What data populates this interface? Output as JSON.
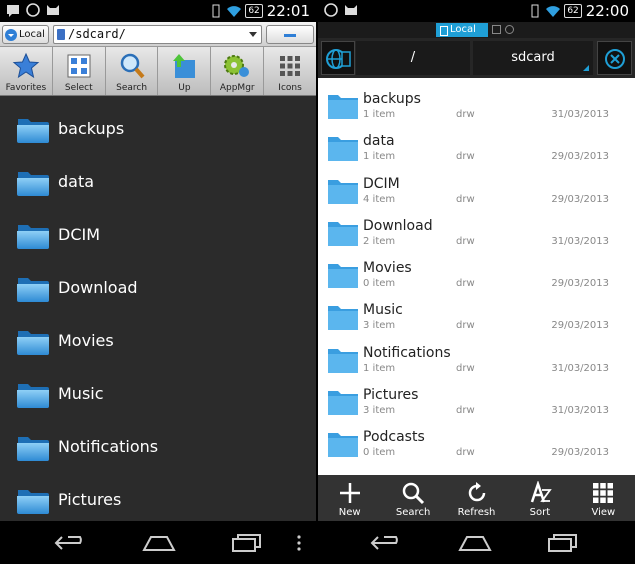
{
  "left_screen": {
    "status": {
      "battery": "62",
      "time": "22:01"
    },
    "location_button": "Local",
    "path": "/sdcard/",
    "toolbar": [
      {
        "label": "Favorites",
        "icon": "star-icon"
      },
      {
        "label": "Select",
        "icon": "checklist-icon"
      },
      {
        "label": "Search",
        "icon": "magnifier-icon"
      },
      {
        "label": "Up",
        "icon": "up-arrow-icon"
      },
      {
        "label": "AppMgr",
        "icon": "gear-icon"
      },
      {
        "label": "Icons",
        "icon": "grid-icon"
      }
    ],
    "folders": [
      "backups",
      "data",
      "DCIM",
      "Download",
      "Movies",
      "Music",
      "Notifications",
      "Pictures"
    ]
  },
  "right_screen": {
    "status": {
      "battery": "62",
      "time": "22:00"
    },
    "tab_label": "Local",
    "breadcrumb": [
      "/",
      "sdcard"
    ],
    "folders": [
      {
        "name": "backups",
        "count": "1 item",
        "perm": "drw",
        "date": "31/03/2013"
      },
      {
        "name": "data",
        "count": "1 item",
        "perm": "drw",
        "date": "29/03/2013"
      },
      {
        "name": "DCIM",
        "count": "4 item",
        "perm": "drw",
        "date": "29/03/2013"
      },
      {
        "name": "Download",
        "count": "2 item",
        "perm": "drw",
        "date": "31/03/2013"
      },
      {
        "name": "Movies",
        "count": "0 item",
        "perm": "drw",
        "date": "29/03/2013"
      },
      {
        "name": "Music",
        "count": "3 item",
        "perm": "drw",
        "date": "29/03/2013"
      },
      {
        "name": "Notifications",
        "count": "1 item",
        "perm": "drw",
        "date": "31/03/2013"
      },
      {
        "name": "Pictures",
        "count": "3 item",
        "perm": "drw",
        "date": "31/03/2013"
      },
      {
        "name": "Podcasts",
        "count": "0 item",
        "perm": "drw",
        "date": "29/03/2013"
      }
    ],
    "bottom_bar": [
      {
        "label": "New",
        "icon": "plus-icon"
      },
      {
        "label": "Search",
        "icon": "magnifier-icon"
      },
      {
        "label": "Refresh",
        "icon": "refresh-icon"
      },
      {
        "label": "Sort",
        "icon": "sort-icon"
      },
      {
        "label": "View",
        "icon": "grid-icon"
      }
    ]
  },
  "colors": {
    "accent": "#1f9fd6",
    "folder": "#4ea8e0",
    "dark_bg": "#2b2b2b"
  }
}
